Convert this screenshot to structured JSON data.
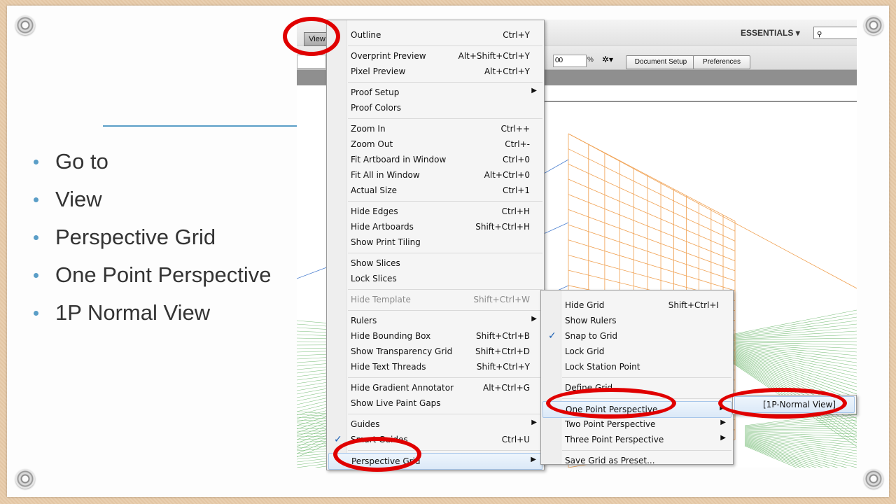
{
  "bullets": [
    "Go to",
    "View",
    "Perspective  Grid",
    "One Point Perspective",
    "1P Normal  View"
  ],
  "toolbar": {
    "view": "View",
    "essentials": "ESSENTIALS",
    "zoom_value": "00",
    "percent": "%",
    "document_setup": "Document Setup",
    "preferences": "Preferences"
  },
  "view_menu": [
    {
      "label": "Outline",
      "shortcut": "Ctrl+Y"
    },
    {
      "label": "Overprint Preview",
      "shortcut": "Alt+Shift+Ctrl+Y"
    },
    {
      "label": "Pixel Preview",
      "shortcut": "Alt+Ctrl+Y"
    },
    {
      "label": "Proof Setup",
      "shortcut": "",
      "submenu": true
    },
    {
      "label": "Proof Colors",
      "shortcut": ""
    },
    {
      "label": "Zoom In",
      "shortcut": "Ctrl++"
    },
    {
      "label": "Zoom Out",
      "shortcut": "Ctrl+-"
    },
    {
      "label": "Fit Artboard in Window",
      "shortcut": "Ctrl+0"
    },
    {
      "label": "Fit All in Window",
      "shortcut": "Alt+Ctrl+0"
    },
    {
      "label": "Actual Size",
      "shortcut": "Ctrl+1"
    },
    {
      "label": "Hide Edges",
      "shortcut": "Ctrl+H"
    },
    {
      "label": "Hide Artboards",
      "shortcut": "Shift+Ctrl+H"
    },
    {
      "label": "Show Print Tiling",
      "shortcut": ""
    },
    {
      "label": "Show Slices",
      "shortcut": ""
    },
    {
      "label": "Lock Slices",
      "shortcut": ""
    },
    {
      "label": "Hide Template",
      "shortcut": "Shift+Ctrl+W",
      "disabled": true
    },
    {
      "label": "Rulers",
      "shortcut": "",
      "submenu": true
    },
    {
      "label": "Hide Bounding Box",
      "shortcut": "Shift+Ctrl+B"
    },
    {
      "label": "Show Transparency Grid",
      "shortcut": "Shift+Ctrl+D"
    },
    {
      "label": "Hide Text Threads",
      "shortcut": "Shift+Ctrl+Y"
    },
    {
      "label": "Hide Gradient Annotator",
      "shortcut": "Alt+Ctrl+G"
    },
    {
      "label": "Show Live Paint Gaps",
      "shortcut": ""
    },
    {
      "label": "Guides",
      "shortcut": "",
      "submenu": true
    },
    {
      "label": "Smart Guides",
      "shortcut": "Ctrl+U",
      "checked": true
    },
    {
      "label": "Perspective Grid",
      "shortcut": "",
      "submenu": true,
      "highlighted": true
    }
  ],
  "perspective_menu": [
    {
      "label": "Hide Grid",
      "shortcut": "Shift+Ctrl+I"
    },
    {
      "label": "Show Rulers",
      "shortcut": ""
    },
    {
      "label": "Snap to Grid",
      "shortcut": "",
      "checked": true
    },
    {
      "label": "Lock Grid",
      "shortcut": ""
    },
    {
      "label": "Lock Station Point",
      "shortcut": ""
    },
    {
      "label": "Define Grid...",
      "shortcut": ""
    },
    {
      "label": "One Point Perspective",
      "shortcut": "",
      "submenu": true,
      "highlighted": true
    },
    {
      "label": "Two Point Perspective",
      "shortcut": "",
      "submenu": true
    },
    {
      "label": "Three Point Perspective",
      "shortcut": "",
      "submenu": true
    },
    {
      "label": "Save Grid as Preset...",
      "shortcut": ""
    }
  ],
  "one_point_menu": [
    {
      "label": "[1P-Normal View]"
    }
  ],
  "colors": {
    "highlight_ellipse": "#e00000",
    "bullet_accent": "#5a9ec7",
    "grid_orange": "#f0a050",
    "grid_green": "#6bb36b",
    "grid_blue": "#4a7fd0"
  }
}
